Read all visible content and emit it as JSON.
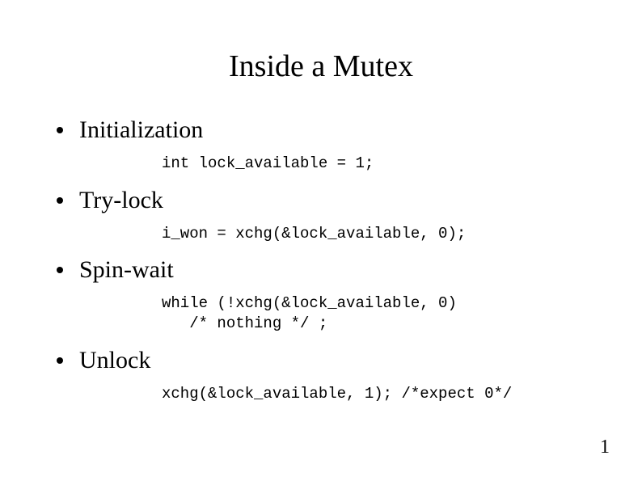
{
  "title": "Inside a Mutex",
  "items": [
    {
      "label": "Initialization",
      "code": "int lock_available = 1;"
    },
    {
      "label": "Try-lock",
      "code": "i_won = xchg(&lock_available, 0);"
    },
    {
      "label": "Spin-wait",
      "code": "while (!xchg(&lock_available, 0)\n   /* nothing */ ;"
    },
    {
      "label": "Unlock",
      "code": "xchg(&lock_available, 1); /*expect 0*/"
    }
  ],
  "pageNumber": "1"
}
